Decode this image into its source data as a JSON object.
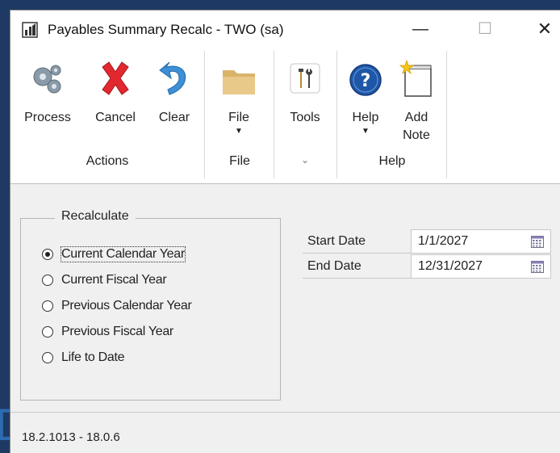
{
  "window": {
    "title": "Payables Summary Recalc  -  TWO (sa)",
    "minimize_glyph": "—",
    "maximize_glyph": "☐",
    "close_glyph": "✕"
  },
  "ribbon": {
    "groups": [
      {
        "label": "Actions",
        "buttons": [
          {
            "label": "Process",
            "icon": "gears-icon"
          },
          {
            "label": "Cancel",
            "icon": "red-x-icon"
          },
          {
            "label": "Clear",
            "icon": "undo-arrow-icon"
          }
        ]
      },
      {
        "label": "File",
        "buttons": [
          {
            "label": "File",
            "icon": "folder-icon",
            "has_dropdown": true
          }
        ]
      },
      {
        "label": "",
        "buttons": [
          {
            "label": "Tools",
            "icon": "tools-icon"
          }
        ],
        "launcher": true
      },
      {
        "label": "Help",
        "buttons": [
          {
            "label": "Help",
            "icon": "help-question-icon",
            "has_dropdown": true
          },
          {
            "label": "Add\nNote",
            "line1": "Add",
            "line2": "Note",
            "icon": "add-note-icon"
          }
        ]
      }
    ],
    "dropdown_glyph": "▼"
  },
  "recalculate": {
    "legend": "Recalculate",
    "options": [
      {
        "label": "Current Calendar Year",
        "selected": true
      },
      {
        "label": "Current Fiscal Year",
        "selected": false
      },
      {
        "label": "Previous Calendar Year",
        "selected": false
      },
      {
        "label": "Previous Fiscal Year",
        "selected": false
      },
      {
        "label": "Life to Date",
        "selected": false
      }
    ]
  },
  "dates": {
    "start_label": "Start Date",
    "start_value": "1/1/2027",
    "end_label": "End Date",
    "end_value": "12/31/2027"
  },
  "status": {
    "version": "18.2.1013 - 18.0.6"
  },
  "colors": {
    "accent": "#1e3a64",
    "cancel_red": "#e0282e",
    "help_blue": "#1f57a8"
  }
}
